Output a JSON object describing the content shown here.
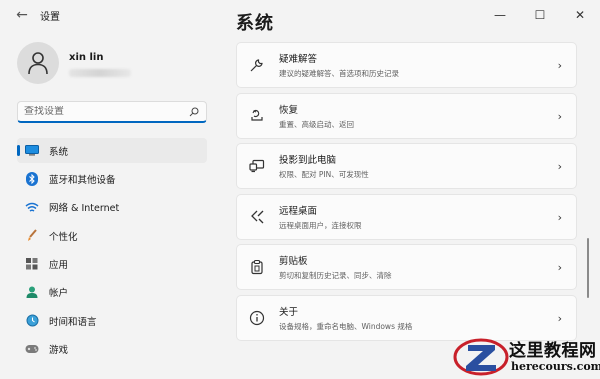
{
  "window": {
    "app_title": "设置",
    "back_glyph": "←",
    "min_glyph": "—",
    "max_glyph": "☐",
    "close_glyph": "✕"
  },
  "profile": {
    "username": "xin lin"
  },
  "search": {
    "placeholder": "查找设置"
  },
  "sidebar": {
    "items": [
      {
        "label": "系统",
        "icon": "system-icon",
        "active": true
      },
      {
        "label": "蓝牙和其他设备",
        "icon": "bluetooth-icon"
      },
      {
        "label": "网络 & Internet",
        "icon": "network-icon"
      },
      {
        "label": "个性化",
        "icon": "personalization-icon"
      },
      {
        "label": "应用",
        "icon": "apps-icon"
      },
      {
        "label": "帐户",
        "icon": "account-icon"
      },
      {
        "label": "时间和语言",
        "icon": "time-language-icon"
      },
      {
        "label": "游戏",
        "icon": "gaming-icon"
      }
    ]
  },
  "main": {
    "title": "系统",
    "cards": [
      {
        "title": "疑难解答",
        "subtitle": "建议的疑难解答、首选项和历史记录",
        "icon": "wrench-icon"
      },
      {
        "title": "恢复",
        "subtitle": "重置、高级启动、返回",
        "icon": "recovery-icon"
      },
      {
        "title": "投影到此电脑",
        "subtitle": "权限、配对 PIN、可发现性",
        "icon": "projection-icon"
      },
      {
        "title": "远程桌面",
        "subtitle": "远程桌面用户，连接权限",
        "icon": "remote-desktop-icon"
      },
      {
        "title": "剪贴板",
        "subtitle": "剪切和复制历史记录、同步、清除",
        "icon": "clipboard-icon"
      },
      {
        "title": "关于",
        "subtitle": "设备规格，重命名电脑、Windows 规格",
        "icon": "info-icon"
      }
    ],
    "chevron": "›"
  },
  "watermark": {
    "line1": "这里教程网",
    "line2": "herecours.com"
  },
  "colors": {
    "accent": "#0067c0",
    "background": "#f3f3f3",
    "card": "#fbfbfb"
  }
}
